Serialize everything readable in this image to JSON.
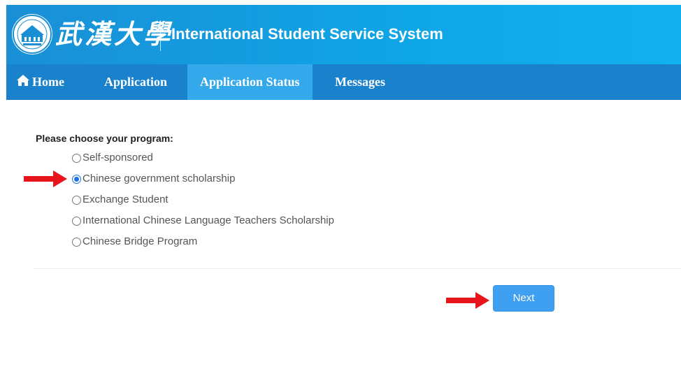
{
  "header": {
    "logo_chars": "武漢大學",
    "title": "International Student Service System"
  },
  "nav": {
    "home": "Home",
    "application": "Application",
    "application_status": "Application Status",
    "messages": "Messages",
    "active": "application_status"
  },
  "form": {
    "prompt": "Please choose your program:",
    "options": [
      {
        "label": "Self-sponsored",
        "selected": false
      },
      {
        "label": "Chinese government scholarship",
        "selected": true
      },
      {
        "label": "Exchange Student",
        "selected": false
      },
      {
        "label": "International Chinese Language Teachers Scholarship",
        "selected": false
      },
      {
        "label": "Chinese Bridge Program",
        "selected": false
      }
    ],
    "next_label": "Next"
  },
  "colors": {
    "header": "#1a8fd6",
    "nav": "#1a82cc",
    "nav_active": "#33a8ea",
    "button": "#3f9ff0",
    "annotation_arrow": "#e8141b"
  }
}
